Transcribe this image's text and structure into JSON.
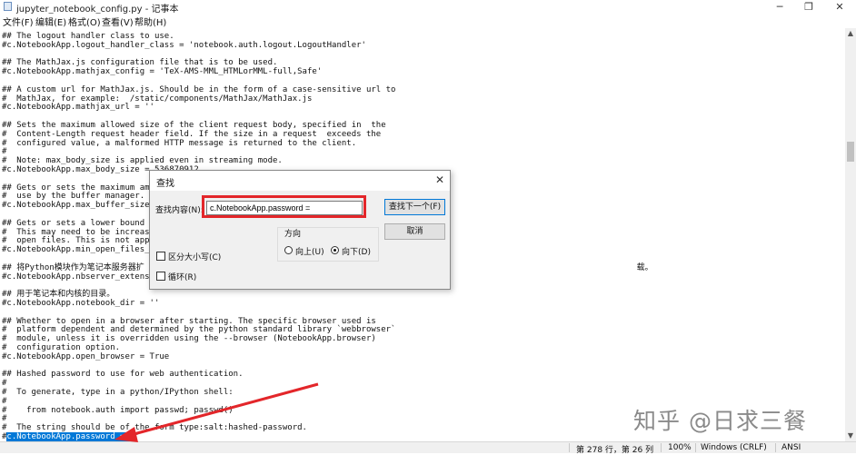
{
  "window": {
    "title": "jupyter_notebook_config.py - 记事本",
    "controls": [
      "─",
      "❐",
      "✕"
    ]
  },
  "menu": [
    "文件(F)",
    "编辑(E)",
    "格式(O)",
    "查看(V)",
    "帮助(H)"
  ],
  "editor": {
    "lines": [
      "## The logout handler class to use.",
      "#c.NotebookApp.logout_handler_class = 'notebook.auth.logout.LogoutHandler'",
      "",
      "## The MathJax.js configuration file that is to be used.",
      "#c.NotebookApp.mathjax_config = 'TeX-AMS-MML_HTMLorMML-full,Safe'",
      "",
      "## A custom url for MathJax.js. Should be in the form of a case-sensitive url to",
      "#  MathJax, for example:  /static/components/MathJax/MathJax.js",
      "#c.NotebookApp.mathjax_url = ''",
      "",
      "## Sets the maximum allowed size of the client request body, specified in  the",
      "#  Content-Length request header field. If the size in a request  exceeds the",
      "#  configured value, a malformed HTTP message is returned to the client.",
      "#",
      "#  Note: max_body_size is applied even in streaming mode.",
      "#c.NotebookApp.max_body_size = 536870912",
      "",
      "## Gets or sets the maximum amount",
      "#  use by the buffer manager.",
      "#c.NotebookApp.max_buffer_size = 5",
      "",
      "## Gets or sets a lower bound on t",
      "#  This may need to be increased i",
      "#  open files. This is not applica",
      "#c.NotebookApp.min_open_files_limi",
      "",
      "## 将Python模块作为笔记本服务器扩                                                                                                    载。",
      "#c.NotebookApp.nbserver_extensions",
      "",
      "## 用于笔记本和内核的目录。",
      "#c.NotebookApp.notebook_dir = ''",
      "",
      "## Whether to open in a browser after starting. The specific browser used is",
      "#  platform dependent and determined by the python standard library `webbrowser`",
      "#  module, unless it is overridden using the --browser (NotebookApp.browser)",
      "#  configuration option.",
      "#c.NotebookApp.open_browser = True",
      "",
      "## Hashed password to use for web authentication.",
      "#",
      "#  To generate, type in a python/IPython shell:",
      "#",
      "#    from notebook.auth import passwd; passwd()",
      "#",
      "#  The string should be of the form type:salt:hashed-password."
    ],
    "selected_prefix": "#",
    "selected_text": "c.NotebookApp.password = ",
    "selected_suffix": "''"
  },
  "find_dialog": {
    "title": "查找",
    "close": "✕",
    "find_label": "查找内容(N):",
    "find_value": "c.NotebookApp.password =",
    "find_next_button": "查找下一个(F)",
    "cancel_button": "取消",
    "direction_label": "方向",
    "up_label": "向上(U)",
    "down_label": "向下(D)",
    "direction_selected": "down",
    "match_case_label": "区分大小写(C)",
    "match_case_checked": false,
    "wrap_label": "循环(R)",
    "wrap_checked": false
  },
  "status_bar": {
    "position": "第 278 行，第 26 列",
    "zoom": "100%",
    "line_ending": "Windows (CRLF)",
    "encoding": "ANSI"
  },
  "watermark": "知乎 @日求三餐",
  "annotation_color": "#e3262a",
  "selection_color": "#0078d7"
}
